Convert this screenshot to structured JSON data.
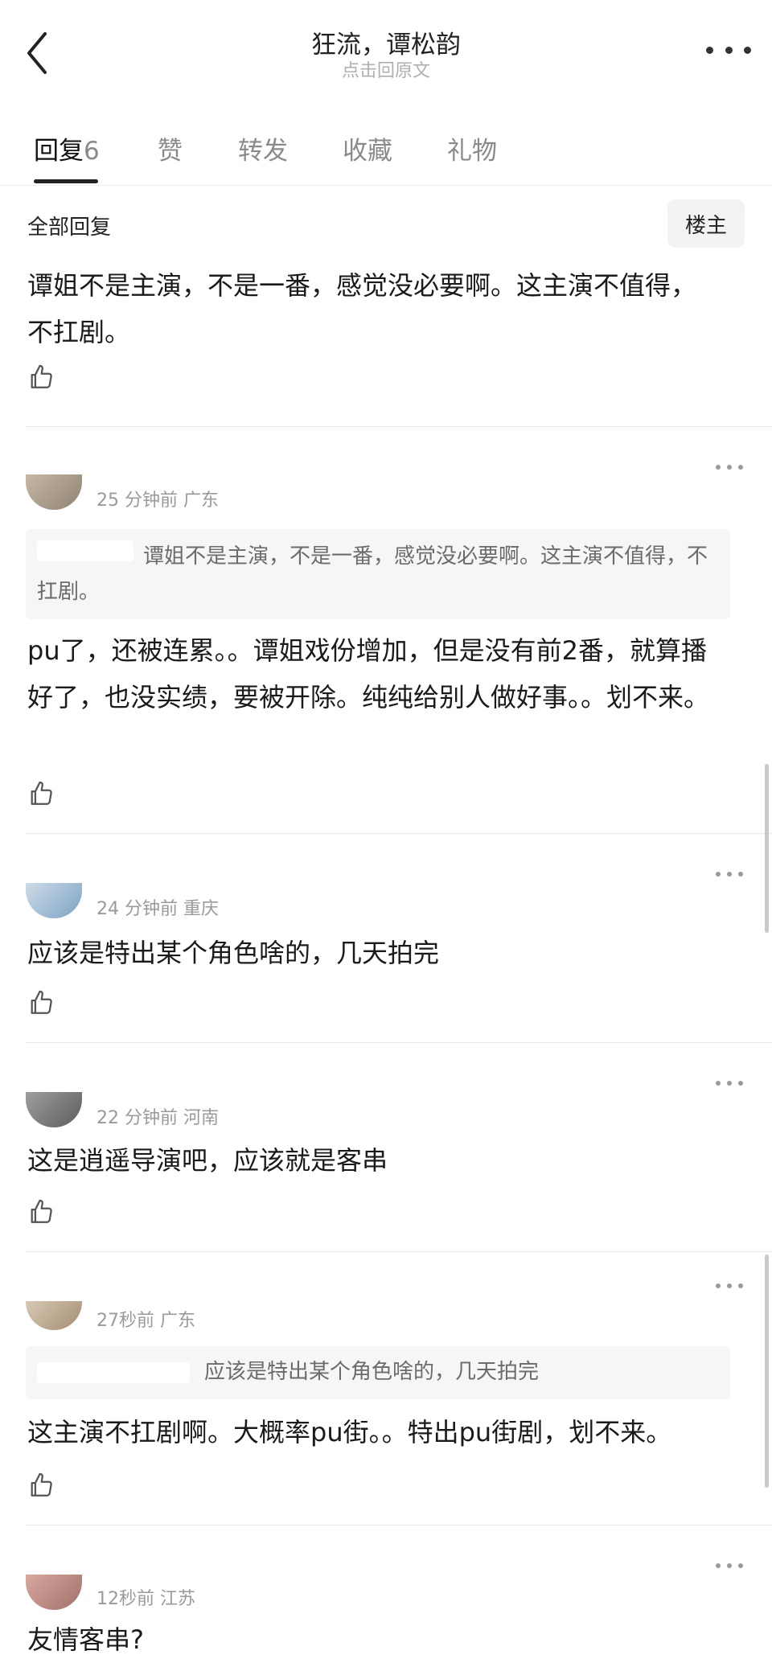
{
  "header": {
    "title": "狂流，谭松韵",
    "subtitle": "点击回原文"
  },
  "tabs": [
    {
      "label": "回复",
      "count": "6"
    },
    {
      "label": "赞"
    },
    {
      "label": "转发"
    },
    {
      "label": "收藏"
    },
    {
      "label": "礼物"
    }
  ],
  "sort_label": "全部回复",
  "op_badge": "楼主",
  "post": {
    "text": "谭姐不是主演，不是一番，感觉没必要啊。这主演不值得，不扛剧。"
  },
  "replies": [
    {
      "meta": "25 分钟前 广东",
      "quote": "谭姐不是主演，不是一番，感觉没必要啊。这主演不值得，不扛剧。",
      "text": "pu了，还被连累。。谭姐戏份增加，但是没有前2番，就算播好了，也没实绩，要被开除。纯纯给别人做好事。。划不来。"
    },
    {
      "meta": "24 分钟前 重庆",
      "text": "应该是特出某个角色啥的，几天拍完"
    },
    {
      "meta": "22 分钟前 河南",
      "text": "这是逍遥导演吧，应该就是客串"
    },
    {
      "meta": "27秒前 广东",
      "quote": "应该是特出某个角色啥的，几天拍完",
      "text": "这主演不扛剧啊。大概率pu街。。特出pu街剧，划不来。"
    },
    {
      "meta": "12秒前 江苏",
      "text": "友情客串?"
    }
  ],
  "icons": {
    "back": "back-arrow-icon",
    "more": "more-icon",
    "like": "thumbs-up-icon",
    "reply_more": "more-dots-icon"
  }
}
